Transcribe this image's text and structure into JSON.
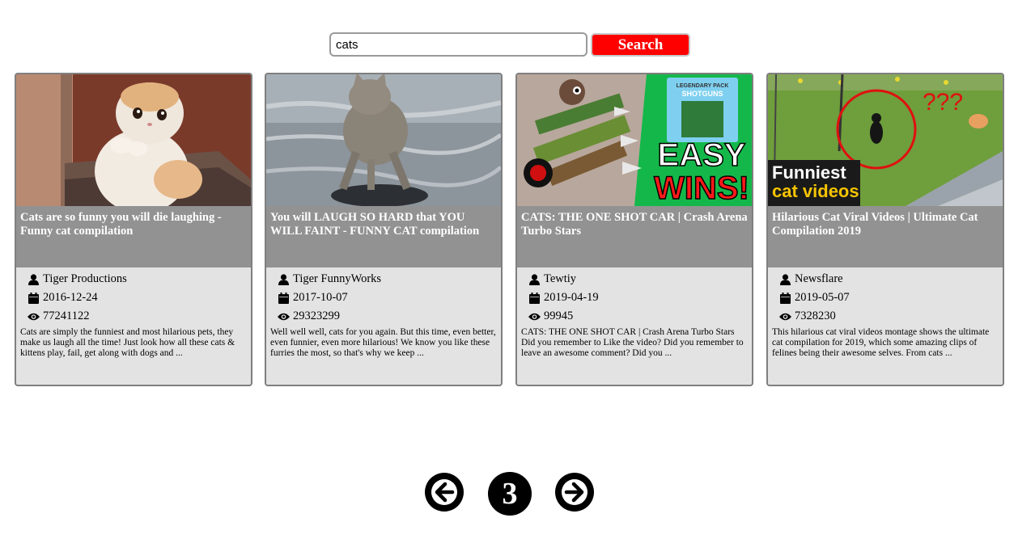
{
  "search": {
    "query": "cats",
    "button_label": "Search"
  },
  "videos": [
    {
      "title": "Cats are so funny you will die laughing - Funny cat compilation",
      "channel": "Tiger Productions",
      "date": "2016-12-24",
      "views": "77241122",
      "description": "Cats are simply the funniest and most hilarious pets, they make us laugh all the time! Just look how all these cats & kittens play, fail, get along with dogs and ..."
    },
    {
      "title": "You will LAUGH SO HARD that YOU WILL FAINT - FUNNY CAT compilation",
      "channel": "Tiger FunnyWorks",
      "date": "2017-10-07",
      "views": "29323299",
      "description": "Well well well, cats for you again. But this time, even better, even funnier, even more hilarious! We know you like these furries the most, so that's why we keep ..."
    },
    {
      "title": "CATS: THE ONE SHOT CAR | Crash Arena Turbo Stars",
      "channel": "Tewtiy",
      "date": "2019-04-19",
      "views": "99945",
      "description": "CATS: THE ONE SHOT CAR | Crash Arena Turbo Stars Did you remember to Like the video? Did you remember to leave an awesome comment? Did you ...",
      "thumb_text": {
        "pack_line1": "LEGENDARY PACK",
        "pack_line2": "SHOTGUNS",
        "big1": "EASY",
        "big2": "WINS!"
      }
    },
    {
      "title": "Hilarious Cat Viral Videos | Ultimate Cat Compilation 2019",
      "channel": "Newsflare",
      "date": "2019-05-07",
      "views": "7328230",
      "description": "This hilarious cat viral videos montage shows the ultimate cat compilation for 2019, which some amazing clips of felines being their awesome selves. From cats ...",
      "thumb_text": {
        "marks": "???",
        "line1": "Funniest",
        "line2": "cat videos"
      }
    }
  ],
  "pagination": {
    "current_page": "3"
  },
  "colors": {
    "search_button": "#ff0000",
    "card_background": "#e3e3e3",
    "title_band": "#929292"
  }
}
